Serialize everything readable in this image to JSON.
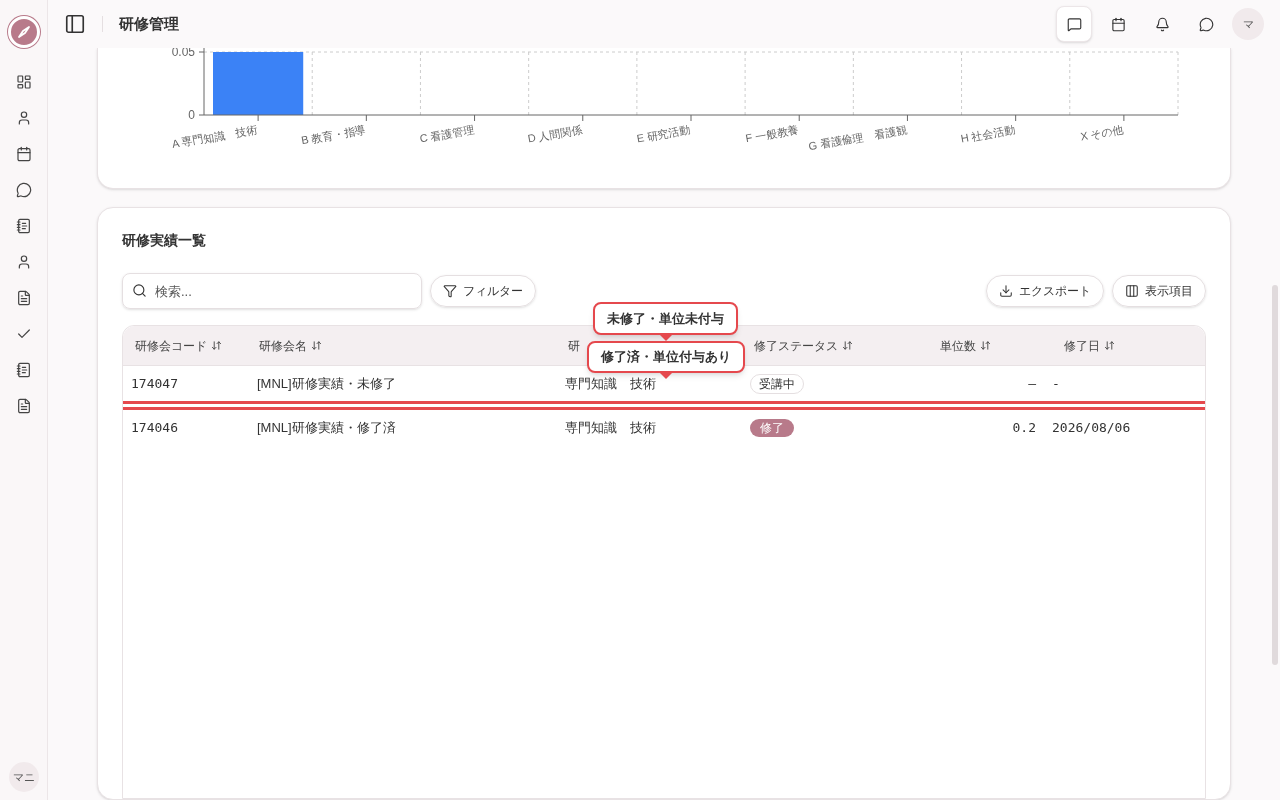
{
  "header": {
    "title": "研修管理",
    "avatar": "マ"
  },
  "sidebar": {
    "user": "マニ"
  },
  "chart": {
    "chart_data": {
      "type": "bar",
      "categories": [
        "A 専門知識　技術",
        "B 教育・指導",
        "C 看護管理",
        "D 人間関係",
        "E 研究活動",
        "F 一般教養",
        "G 看護倫理　看護観",
        "H 社会活動",
        "X その他"
      ],
      "values": [
        0.05,
        0,
        0,
        0,
        0,
        0,
        0,
        0,
        0
      ],
      "ylim": [
        0,
        0.05
      ],
      "yticks": [
        {
          "value": 0,
          "label": "0"
        },
        {
          "value": 0.05,
          "label": "0.05"
        }
      ]
    }
  },
  "section": {
    "title": "研修実績一覧",
    "search": {
      "placeholder": "検索..."
    },
    "filter": "フィルター",
    "export": "エクスポート",
    "columns_button": "表示項目"
  },
  "table": {
    "columns": [
      {
        "label": "研修会コード",
        "sort_icon": true
      },
      {
        "label": "研修会名",
        "sort_icon": true
      },
      {
        "label": "研",
        "sort_icon": false
      },
      {
        "label": "修了ステータス",
        "sort_icon": true
      },
      {
        "label": "単位数",
        "sort_icon": true
      },
      {
        "label": "修了日",
        "sort_icon": true
      }
    ],
    "rows": [
      {
        "code": "174047",
        "name": "[MNL]研修実績・未修了",
        "category": "専門知識　技術",
        "status": {
          "label": "受講中",
          "kind": "outline"
        },
        "units": "–",
        "date": "-",
        "highlighted": true
      },
      {
        "code": "174046",
        "name": "[MNL]研修実績・修了済",
        "category": "専門知識　技術",
        "status": {
          "label": "修了",
          "kind": "filled"
        },
        "units": "0.2",
        "date": "2026/08/06",
        "highlighted": true
      }
    ]
  },
  "tooltips": [
    "未修了・単位未付与",
    "修了済・単位付与あり"
  ]
}
